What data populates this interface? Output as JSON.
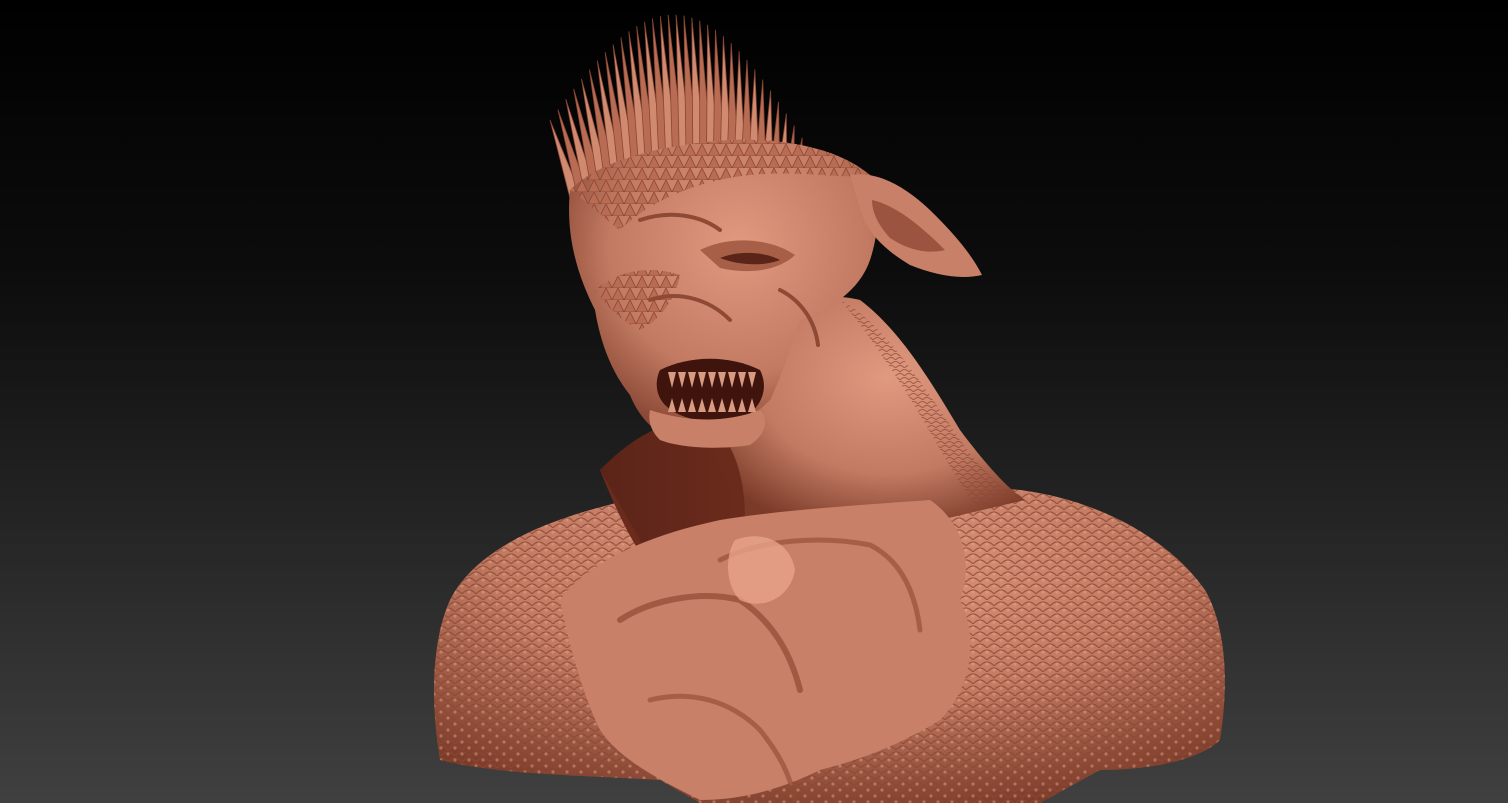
{
  "viewport": {
    "background_top_color": "#000000",
    "background_bottom_color": "#404040",
    "model_color": "#c27a62",
    "model_shadow_color": "#7a3a28",
    "model_highlight_color": "#e09a80"
  },
  "model": {
    "subject": "sculpted-creature-bust",
    "material": "clay-matcap"
  }
}
